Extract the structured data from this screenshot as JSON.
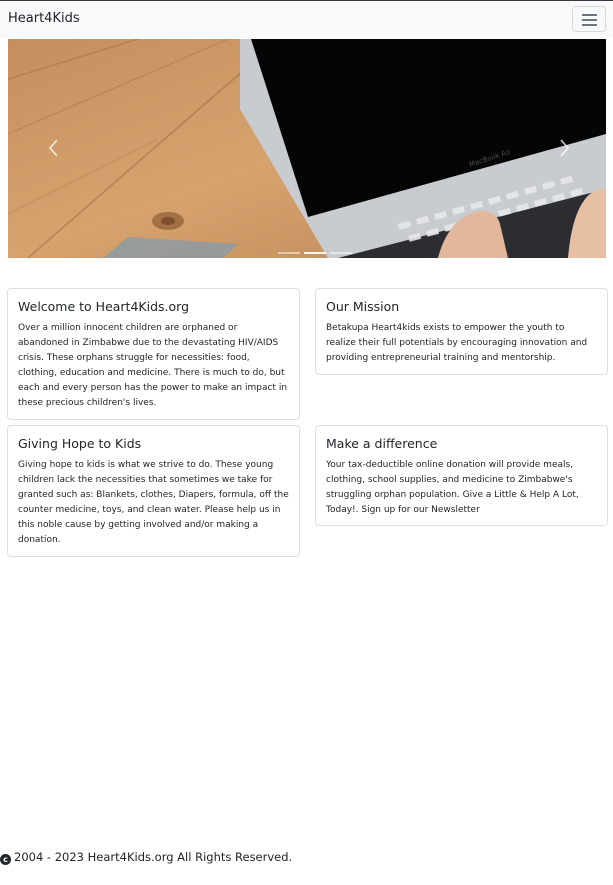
{
  "navbar": {
    "brand": "Heart4Kids",
    "toggle_icon": "hamburger-menu-icon"
  },
  "carousel": {
    "laptop_label": "MacBook Air",
    "slide_count": 3,
    "active_slide": 2,
    "prev_icon": "chevron-left-icon",
    "next_icon": "chevron-right-icon"
  },
  "cards": [
    {
      "title": "Welcome to Heart4Kids.org",
      "body": "Over a million innocent children are orphaned or abandoned in Zimbabwe due to the devastating HIV/AIDS crisis. These orphans struggle for necessities: food, clothing, education and medicine. There is much to do, but each and every person has the power to make an impact in these precious children's lives."
    },
    {
      "title": "Our Mission",
      "body": "Betakupa Heart4kids exists to empower the youth to realize their full potentials by encouraging innovation and providing entrepreneurial training and mentorship."
    },
    {
      "title": "Giving Hope to Kids",
      "body": "Giving hope to kids is what we strive to do. These young children lack the necessities that sometimes we take for granted such as: Blankets, clothes, Diapers, formula, off the counter medicine, toys, and clean water. Please help us in this noble cause by getting involved and/or making a donation."
    },
    {
      "title": "Make a difference",
      "body": "Your tax-deductible online donation will provide meals, clothing, school supplies, and medicine to Zimbabwe's struggling orphan population. Give a Little & Help A Lot, Today!. Sign up for our Newsletter"
    }
  ],
  "footer": {
    "text": "2004 - 2023 Heart4Kids.org All Rights Reserved.",
    "copyright_icon": "copyright-icon"
  },
  "colors": {
    "navbar_bg": "#f8f9fa",
    "card_border": "#dfdfdf",
    "text": "#212529"
  }
}
